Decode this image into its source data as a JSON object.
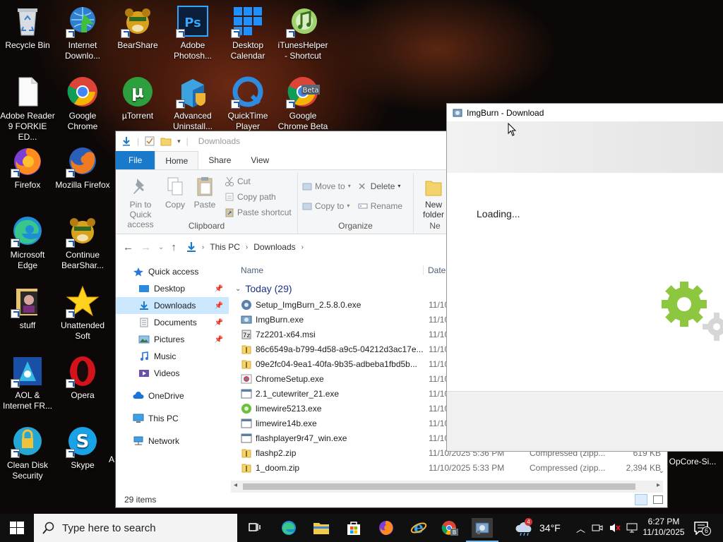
{
  "desktop": {
    "icons": [
      {
        "label": "Recycle Bin",
        "icon": "recycle-bin-icon"
      },
      {
        "label": "Internet Downlo...",
        "icon": "idm-icon"
      },
      {
        "label": "BearShare",
        "icon": "bearshare-icon"
      },
      {
        "label": "Adobe Photosh...",
        "icon": "photoshop-icon"
      },
      {
        "label": "Desktop Calendar",
        "icon": "calendar-icon"
      },
      {
        "label": "iTunesHelper - Shortcut",
        "icon": "itunes-icon"
      },
      {
        "label": "Adobe Reader 9 FORKIE ED...",
        "icon": "file-icon"
      },
      {
        "label": "Google Chrome",
        "icon": "chrome-icon"
      },
      {
        "label": "µTorrent",
        "icon": "utorrent-icon"
      },
      {
        "label": "Advanced Uninstall...",
        "icon": "uninstaller-icon"
      },
      {
        "label": "QuickTime Player",
        "icon": "quicktime-icon"
      },
      {
        "label": "Google Chrome Beta",
        "icon": "chrome-beta-icon"
      },
      {
        "label": "Firefox",
        "icon": "firefox-icon"
      },
      {
        "label": "Mozilla Firefox",
        "icon": "firefox-icon"
      },
      {
        "label": "Microsoft Edge",
        "icon": "edge-icon"
      },
      {
        "label": "Continue BearShar...",
        "icon": "bearshare-icon"
      },
      {
        "label": "stuff",
        "icon": "folder-icon"
      },
      {
        "label": "Unattended Soft",
        "icon": "star-icon"
      },
      {
        "label": "AOL & Internet FR...",
        "icon": "aol-icon"
      },
      {
        "label": "Opera",
        "icon": "opera-icon"
      },
      {
        "label": "Clean Disk Security",
        "icon": "clean-disk-icon"
      },
      {
        "label": "Skype",
        "icon": "skype-icon"
      },
      {
        "label": "A",
        "icon": "partial-icon"
      },
      {
        "label": "OpCore-Si...",
        "icon": "opcore-icon"
      }
    ]
  },
  "explorer": {
    "title": "Downloads",
    "tabs": [
      "File",
      "Home",
      "Share",
      "View"
    ],
    "ribbon": {
      "clipboard": {
        "pin": "Pin to Quick access",
        "copy": "Copy",
        "paste": "Paste",
        "cut": "Cut",
        "copy_path": "Copy path",
        "paste_shortcut": "Paste shortcut",
        "group": "Clipboard"
      },
      "organize": {
        "move_to": "Move to",
        "copy_to": "Copy to",
        "delete": "Delete",
        "rename": "Rename",
        "group": "Organize"
      },
      "new": {
        "new_folder": "New folder",
        "group": "Ne"
      }
    },
    "address": {
      "crumbs": [
        "This PC",
        "Downloads"
      ]
    },
    "nav": {
      "quick_access": "Quick access",
      "desktop": "Desktop",
      "downloads": "Downloads",
      "documents": "Documents",
      "pictures": "Pictures",
      "music": "Music",
      "videos": "Videos",
      "onedrive": "OneDrive",
      "this_pc": "This PC",
      "network": "Network"
    },
    "columns": {
      "name": "Name",
      "date": "Date m"
    },
    "group_header": "Today (29)",
    "files": [
      {
        "name": "Setup_ImgBurn_2.5.8.0.exe",
        "date": "11/10/",
        "type": "",
        "size": "",
        "icon": "installer-icon"
      },
      {
        "name": "ImgBurn.exe",
        "date": "11/10/",
        "type": "",
        "size": "",
        "icon": "imgburn-icon"
      },
      {
        "name": "7z2201-x64.msi",
        "date": "11/10/",
        "type": "",
        "size": "",
        "icon": "msi-icon"
      },
      {
        "name": "86c6549a-b799-4d58-a9c5-04212d3ac17e...",
        "date": "11/10/",
        "type": "",
        "size": "",
        "icon": "zip-icon"
      },
      {
        "name": "09e2fc04-9ea1-40fa-9b35-adbeba1fbd5b...",
        "date": "11/10/",
        "type": "",
        "size": "",
        "icon": "zip-icon"
      },
      {
        "name": "ChromeSetup.exe",
        "date": "11/10/",
        "type": "",
        "size": "",
        "icon": "chrome-icon"
      },
      {
        "name": "2.1_cutewriter_21.exe",
        "date": "11/10/",
        "type": "",
        "size": "",
        "icon": "exe-icon"
      },
      {
        "name": "limewire5213.exe",
        "date": "11/10/",
        "type": "",
        "size": "",
        "icon": "limewire-icon"
      },
      {
        "name": "limewire14b.exe",
        "date": "11/10/",
        "type": "",
        "size": "",
        "icon": "exe-icon"
      },
      {
        "name": "flashplayer9r47_win.exe",
        "date": "11/10/",
        "type": "",
        "size": "",
        "icon": "exe-icon"
      },
      {
        "name": "flashp2.zip",
        "date": "11/10/2025 5:36 PM",
        "type": "Compressed (zipp...",
        "size": "619 KB",
        "icon": "zip-icon"
      },
      {
        "name": "1_doom.zip",
        "date": "11/10/2025 5:33 PM",
        "type": "Compressed (zipp...",
        "size": "2,394 KB",
        "icon": "zip-icon"
      }
    ],
    "status": "29 items"
  },
  "imgburn": {
    "title": "ImgBurn - Download",
    "loading": "Loading..."
  },
  "taskbar": {
    "search_placeholder": "Type here to search",
    "weather": "34°F",
    "time": "6:27 PM",
    "date": "11/10/2025",
    "notifications": "6",
    "weather_badge": "4"
  },
  "colors": {
    "accent": "#1979ca",
    "selection": "#cce8ff",
    "gear_green": "#8dc63f"
  }
}
